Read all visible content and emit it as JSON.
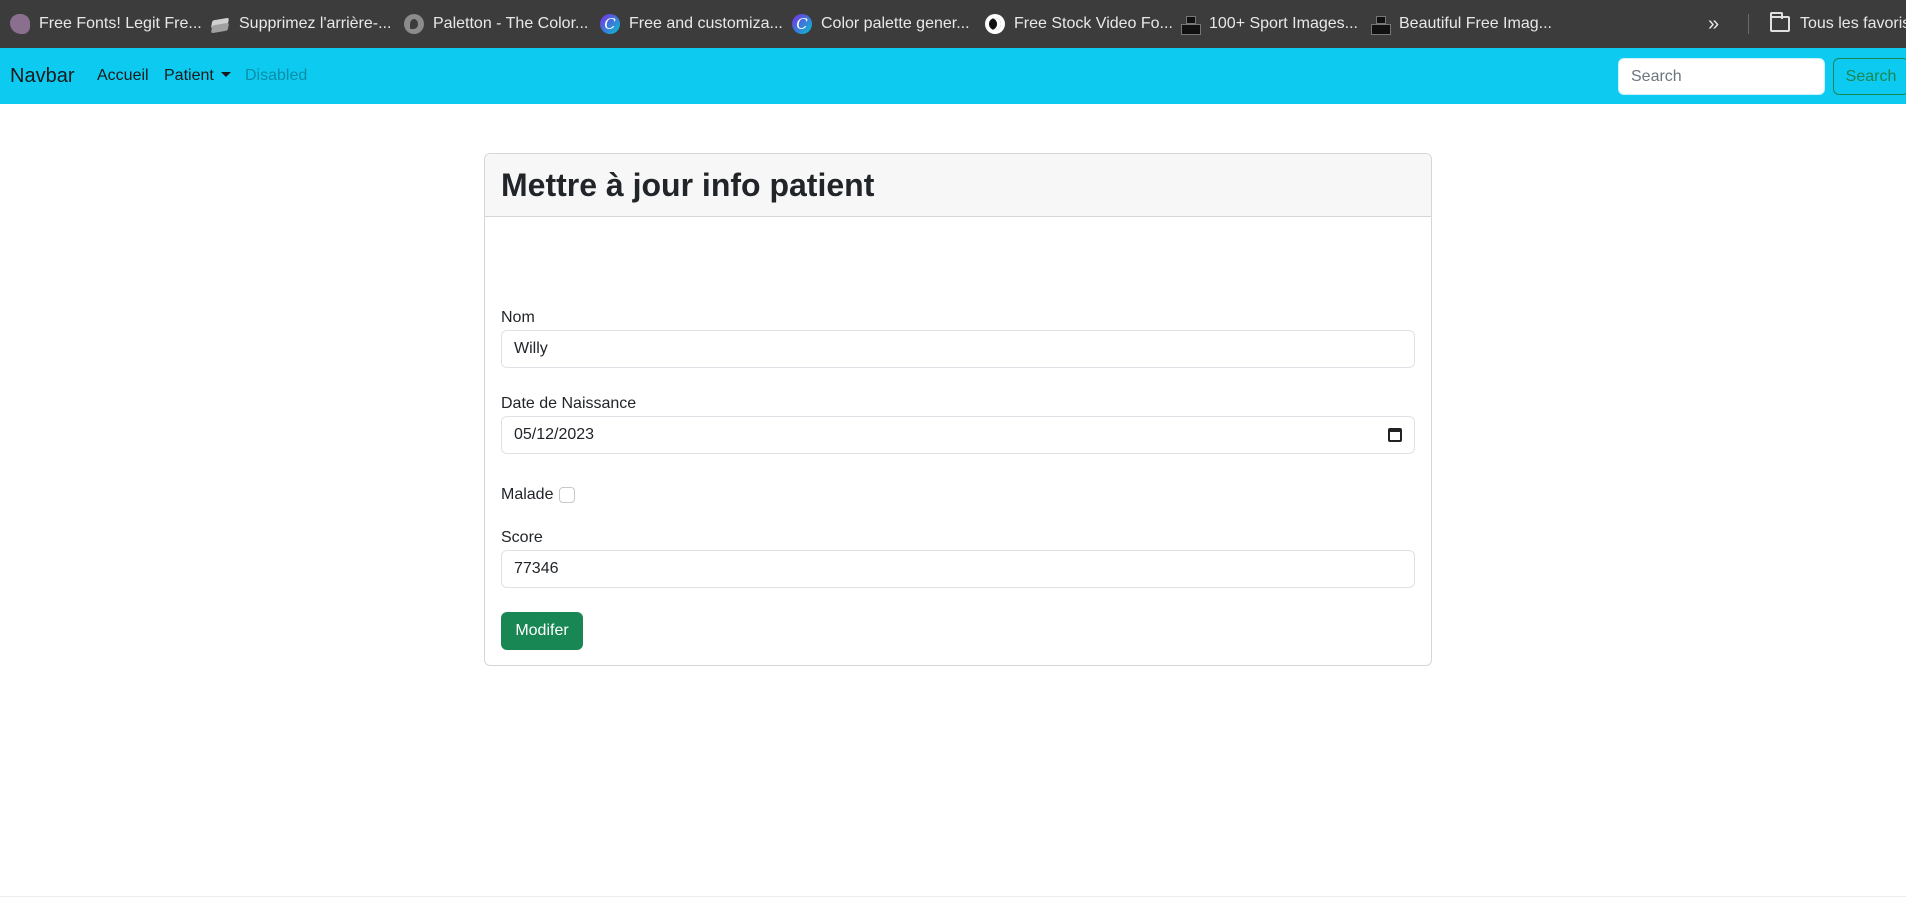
{
  "bookmarks": {
    "items": [
      {
        "label": "Free Fonts! Legit Fre...",
        "icon": "bird-icon"
      },
      {
        "label": "Supprimez l'arrière-...",
        "icon": "layers-icon"
      },
      {
        "label": "Paletton - The Color...",
        "icon": "paletton-icon"
      },
      {
        "label": "Free and customiza...",
        "icon": "canva-icon"
      },
      {
        "label": "Color palette gener...",
        "icon": "canva-icon"
      },
      {
        "label": "Free Stock Video Fo...",
        "icon": "coolors-icon"
      },
      {
        "label": "100+ Sport Images...",
        "icon": "unsplash-icon"
      },
      {
        "label": "Beautiful Free Imag...",
        "icon": "unsplash-icon"
      }
    ],
    "more_label": "»",
    "folder_label": "Tous les favoris"
  },
  "navbar": {
    "brand": "Navbar",
    "links": [
      {
        "label": "Accueil"
      },
      {
        "label": "Patient"
      },
      {
        "label": "Disabled"
      }
    ],
    "search_placeholder": "Search",
    "search_button": "Search",
    "accent_color": "#0dcaf0"
  },
  "card": {
    "title": "Mettre à jour info patient",
    "fields": {
      "nom_label": "Nom",
      "nom_value": "Willy",
      "date_label": "Date de Naissance",
      "date_value": "05/12/2023",
      "malade_label": "Malade",
      "score_label": "Score",
      "score_value": "77346"
    },
    "submit_label": "Modifer",
    "submit_color": "#198754"
  }
}
